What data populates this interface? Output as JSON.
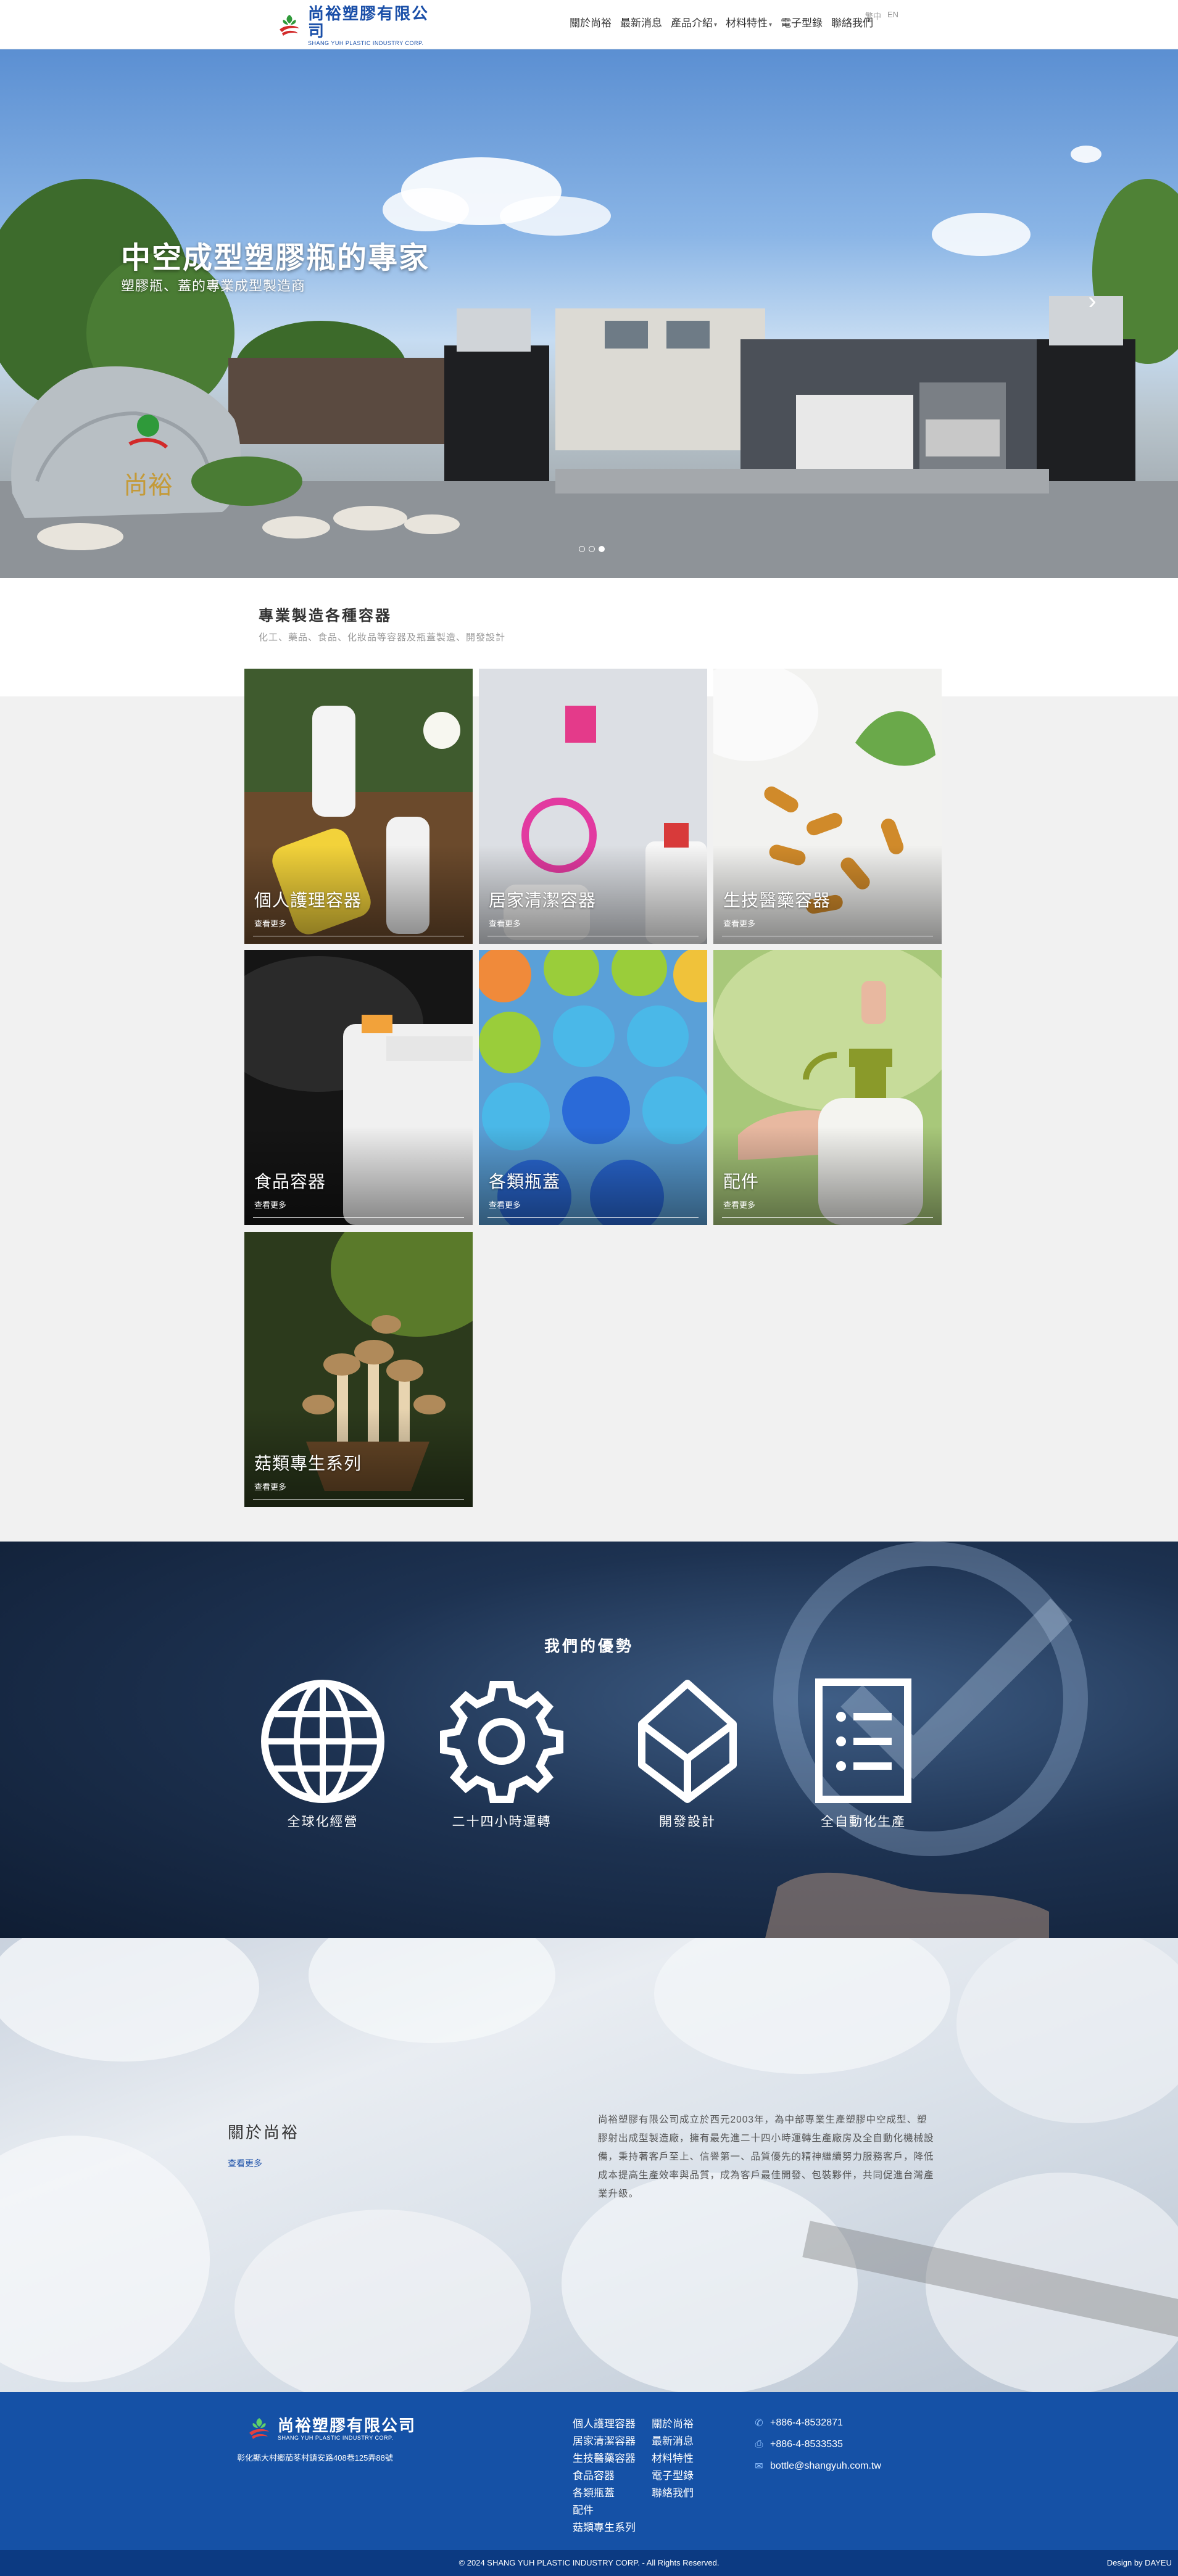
{
  "header": {
    "logo_cn": "尚裕塑膠有限公司",
    "logo_en": "SHANG YUH PLASTIC INDUSTRY CORP.",
    "nav": [
      {
        "label": "關於尚裕",
        "has_dropdown": false
      },
      {
        "label": "最新消息",
        "has_dropdown": false
      },
      {
        "label": "產品介紹",
        "has_dropdown": true
      },
      {
        "label": "材料特性",
        "has_dropdown": true
      },
      {
        "label": "電子型錄",
        "has_dropdown": false
      },
      {
        "label": "聯絡我們",
        "has_dropdown": false
      }
    ],
    "lang": [
      "繁中",
      "EN"
    ]
  },
  "hero": {
    "title": "中空成型塑膠瓶的專家",
    "subtitle": "塑膠瓶、蓋的專業成型製造商",
    "next_icon": "chevron-right-icon",
    "slides": 3,
    "active_slide": 3
  },
  "products": {
    "title": "專業製造各種容器",
    "subtitle": "化工、藥品、食品、化妝品等容器及瓶蓋製造、開發設計",
    "more_label": "查看更多",
    "items": [
      {
        "label": "個人護理容器"
      },
      {
        "label": "居家清潔容器"
      },
      {
        "label": "生技醫藥容器"
      },
      {
        "label": "食品容器"
      },
      {
        "label": "各類瓶蓋"
      },
      {
        "label": "配件"
      },
      {
        "label": "菇類專生系列"
      }
    ]
  },
  "advantages": {
    "title": "我們的優勢",
    "items": [
      {
        "label": "全球化經營",
        "icon": "globe-icon"
      },
      {
        "label": "二十四小時運轉",
        "icon": "gear-icon"
      },
      {
        "label": "開發設計",
        "icon": "box-icon"
      },
      {
        "label": "全自動化生產",
        "icon": "checklist-icon"
      }
    ]
  },
  "about": {
    "title": "關於尚裕",
    "more_label": "查看更多",
    "text": "尚裕塑膠有限公司成立於西元2003年，為中部專業生產塑膠中空成型、塑膠射出成型製造廠，擁有最先進二十四小時運轉生產廠房及全自動化機械設備，秉持著客戶至上、信譽第一、品質優先的精神繼續努力服務客戶，降低成本提高生產效率與品質，成為客戶最佳開發、包裝夥伴，共同促進台灣產業升級。"
  },
  "footer": {
    "logo_cn": "尚裕塑膠有限公司",
    "logo_en": "SHANG YUH PLASTIC INDUSTRY CORP.",
    "address": "彰化縣大村鄉茄苳村鎮安路408巷125弄88號",
    "col1": [
      "個人護理容器",
      "居家清潔容器",
      "生技醫藥容器",
      "食品容器",
      "各類瓶蓋",
      "配件",
      "菇類專生系列"
    ],
    "col2": [
      "關於尚裕",
      "最新消息",
      "材料特性",
      "電子型錄",
      "聯絡我們"
    ],
    "phone": "+886-4-8532871",
    "fax": "+886-4-8533535",
    "email": "bottle@shangyuh.com.tw",
    "copyright": "© 2024 SHANG YUH PLASTIC INDUSTRY CORP. - All Rights Reserved.",
    "design": "Design by DAYEU"
  },
  "colors": {
    "brand_blue": "#1551a6",
    "copybar": "#0c3a82",
    "logo_red": "#d22a2a",
    "logo_green": "#2f9a3a"
  }
}
